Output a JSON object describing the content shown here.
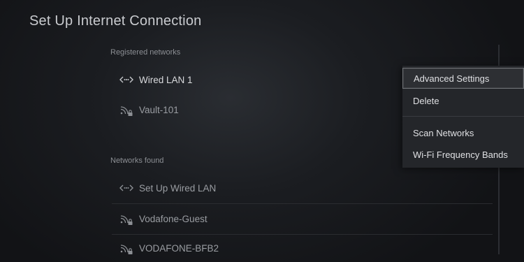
{
  "page": {
    "title": "Set Up Internet Connection"
  },
  "registered": {
    "label": "Registered networks",
    "items": [
      {
        "name": "Wired LAN 1",
        "icon": "wired-lan-icon"
      },
      {
        "name": "Vault-101",
        "icon": "wifi-locked-icon"
      }
    ]
  },
  "found": {
    "label": "Networks found",
    "items": [
      {
        "name": "Set Up Wired LAN",
        "icon": "wired-lan-icon"
      },
      {
        "name": "Vodafone-Guest",
        "icon": "wifi-locked-icon"
      },
      {
        "name": "VODAFONE-BFB2",
        "icon": "wifi-locked-icon"
      }
    ]
  },
  "menu": {
    "items": [
      {
        "label": "Advanced Settings",
        "focused": true
      },
      {
        "label": "Delete"
      },
      {
        "label": "Scan Networks"
      },
      {
        "label": "Wi-Fi Frequency Bands"
      }
    ]
  },
  "colors": {
    "background": "#1b1d21",
    "menu_background": "#24262a",
    "focus_border": "#6f7276"
  }
}
